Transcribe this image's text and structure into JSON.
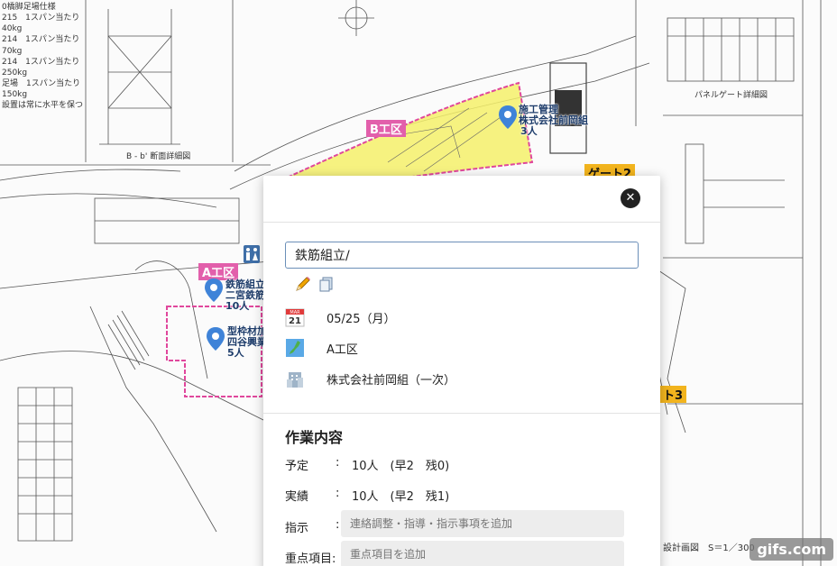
{
  "map": {
    "zone_b": "B工区",
    "zone_a": "A工区",
    "gate2": "ゲート2",
    "gate3": "ト3",
    "pins": [
      {
        "line1": "施工管理",
        "line2": "株式会社前岡組",
        "line3": "3人"
      },
      {
        "line1": "鉄筋組立",
        "line2": "二宮鉄筋",
        "line3": "10人"
      },
      {
        "line1": "型枠材加",
        "line2": "四谷興業",
        "line3": "5人"
      }
    ],
    "drawing_notes": {
      "panel_gate": "パネルゲート詳細図",
      "section": "B - b' 断面詳細図",
      "scale": "設計画図　S＝1／300",
      "top_notes": [
        "0橋脚足場仕様",
        "215　1スパン当たり40kg",
        "214　1スパン当たり70kg",
        "214　1スパン当たり250kg",
        "足場　1スパン当たり150kg",
        "設置は常に水平を保つ"
      ]
    }
  },
  "dialog": {
    "close_label": "✕",
    "title_value": "鉄筋組立/",
    "date": "05/25（月）",
    "calendar_month": "MAR",
    "calendar_day": "21",
    "area": "A工区",
    "company": "株式会社前岡組（一次）",
    "section_title": "作業内容",
    "rows": {
      "plan_label": "予定",
      "plan_value": "10人　(早2　残0)",
      "actual_label": "実績",
      "actual_value": "10人　(早2　残1)",
      "instruction_label": "指示",
      "instruction_placeholder": "連絡調整・指導・指示事項を追加",
      "focus_label": "重点項目:",
      "focus_placeholder": "重点項目を追加"
    },
    "colon": ":"
  },
  "watermark": "gifs.com",
  "colors": {
    "zone_b_fill": "#f4f06a",
    "zone_border": "#e0479c",
    "zone_label_bg": "#e25fab",
    "pin_blue": "#3f83d8",
    "gate_bg": "#f2b41e"
  }
}
